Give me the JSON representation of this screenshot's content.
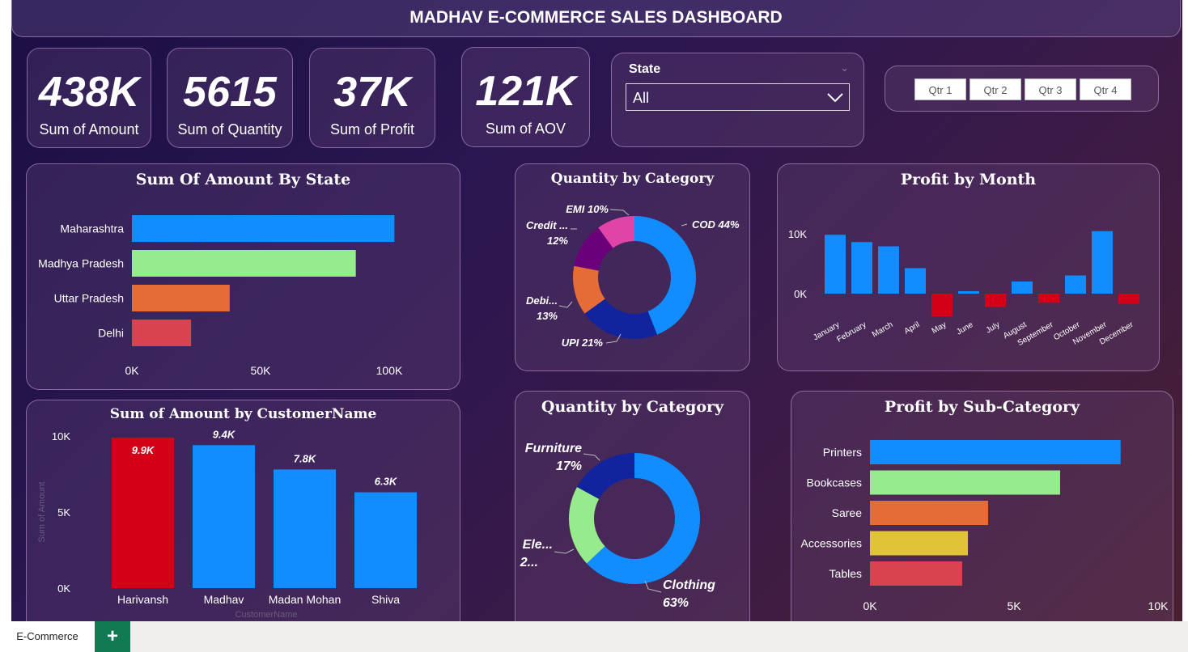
{
  "header": {
    "title": "MADHAV E-COMMERCE SALES DASHBOARD"
  },
  "kpis": [
    {
      "value": "438K",
      "label": "Sum of Amount"
    },
    {
      "value": "5615",
      "label": "Sum of Quantity"
    },
    {
      "value": "37K",
      "label": "Sum of Profit"
    },
    {
      "value": "121K",
      "label": "Sum of AOV"
    }
  ],
  "state_filter": {
    "label": "State",
    "selected": "All"
  },
  "quarters": [
    "Qtr 1",
    "Qtr 2",
    "Qtr 3",
    "Qtr 4"
  ],
  "tabs": {
    "active": "E-Commerce",
    "add": "+"
  },
  "colors": {
    "blue": "#118dff",
    "green": "#96eb8c",
    "orange": "#e66c37",
    "red": "#d9434f",
    "yellow": "#e0c337",
    "darkred": "#d30018"
  },
  "chart_data": [
    {
      "id": "amount_by_state",
      "type": "bar",
      "orientation": "horizontal",
      "title": "Sum Of Amount By State",
      "categories": [
        "Maharashtra",
        "Madhya Pradesh",
        "Uttar Pradesh",
        "Delhi"
      ],
      "values": [
        102000,
        87000,
        38000,
        23000
      ],
      "colors": [
        "#118dff",
        "#96eb8c",
        "#e66c37",
        "#d9434f"
      ],
      "xticks": [
        "0K",
        "50K",
        "100K"
      ],
      "xlim": [
        0,
        100000
      ]
    },
    {
      "id": "quantity_by_payment",
      "type": "pie",
      "title": "Quantity by Category",
      "slices": [
        {
          "label": "COD 44%",
          "value": 44,
          "color": "#118dff"
        },
        {
          "label": "UPI 21%",
          "value": 21,
          "color": "#12239e"
        },
        {
          "label": "Debi...",
          "sublabel": "13%",
          "value": 13,
          "color": "#e66c37"
        },
        {
          "label": "Credit ...",
          "sublabel": "12%",
          "value": 12,
          "color": "#6b007b"
        },
        {
          "label": "EMI 10%",
          "value": 10,
          "color": "#e044a7"
        }
      ]
    },
    {
      "id": "profit_by_month",
      "type": "bar",
      "title": "Profit by Month",
      "categories": [
        "January",
        "February",
        "March",
        "April",
        "May",
        "June",
        "July",
        "August",
        "September",
        "October",
        "November",
        "December"
      ],
      "values": [
        9700,
        8500,
        7800,
        4200,
        -3800,
        400,
        -2200,
        2000,
        -1500,
        3000,
        10300,
        -1700
      ],
      "yticks": [
        "10K",
        "0K"
      ],
      "colors": {
        "positive": "#118dff",
        "negative": "#d30018"
      }
    },
    {
      "id": "amount_by_customer",
      "type": "bar",
      "title": "Sum of Amount by CustomerName",
      "xlabel": "CustomerName",
      "ylabel": "Sum of Amount",
      "categories": [
        "Harivansh",
        "Madhav",
        "Madan Mohan",
        "Shiva"
      ],
      "values": [
        9900,
        9400,
        7800,
        6300
      ],
      "data_labels": [
        "9.9K",
        "9.4K",
        "7.8K",
        "6.3K"
      ],
      "colors": [
        "#d30018",
        "#118dff",
        "#118dff",
        "#118dff"
      ],
      "yticks": [
        "10K",
        "5K",
        "0K"
      ],
      "ylim": [
        0,
        10000
      ]
    },
    {
      "id": "quantity_by_category",
      "type": "pie",
      "title": "Quantity by Category",
      "slices": [
        {
          "label": "Clothing",
          "sublabel": "63%",
          "value": 63,
          "color": "#118dff"
        },
        {
          "label": "Ele...",
          "sublabel": "2...",
          "value": 20,
          "color": "#96eb8c"
        },
        {
          "label": "Furniture",
          "sublabel": "17%",
          "value": 17,
          "color": "#12239e"
        }
      ]
    },
    {
      "id": "profit_by_subcategory",
      "type": "bar",
      "orientation": "horizontal",
      "title": "Profit by Sub-Category",
      "categories": [
        "Printers",
        "Bookcases",
        "Saree",
        "Accessories",
        "Tables"
      ],
      "values": [
        8700,
        6600,
        4100,
        3400,
        3200
      ],
      "colors": [
        "#118dff",
        "#96eb8c",
        "#e66c37",
        "#e0c337",
        "#d9434f"
      ],
      "xticks": [
        "0K",
        "5K",
        "10K"
      ],
      "xlim": [
        0,
        10000
      ]
    }
  ]
}
